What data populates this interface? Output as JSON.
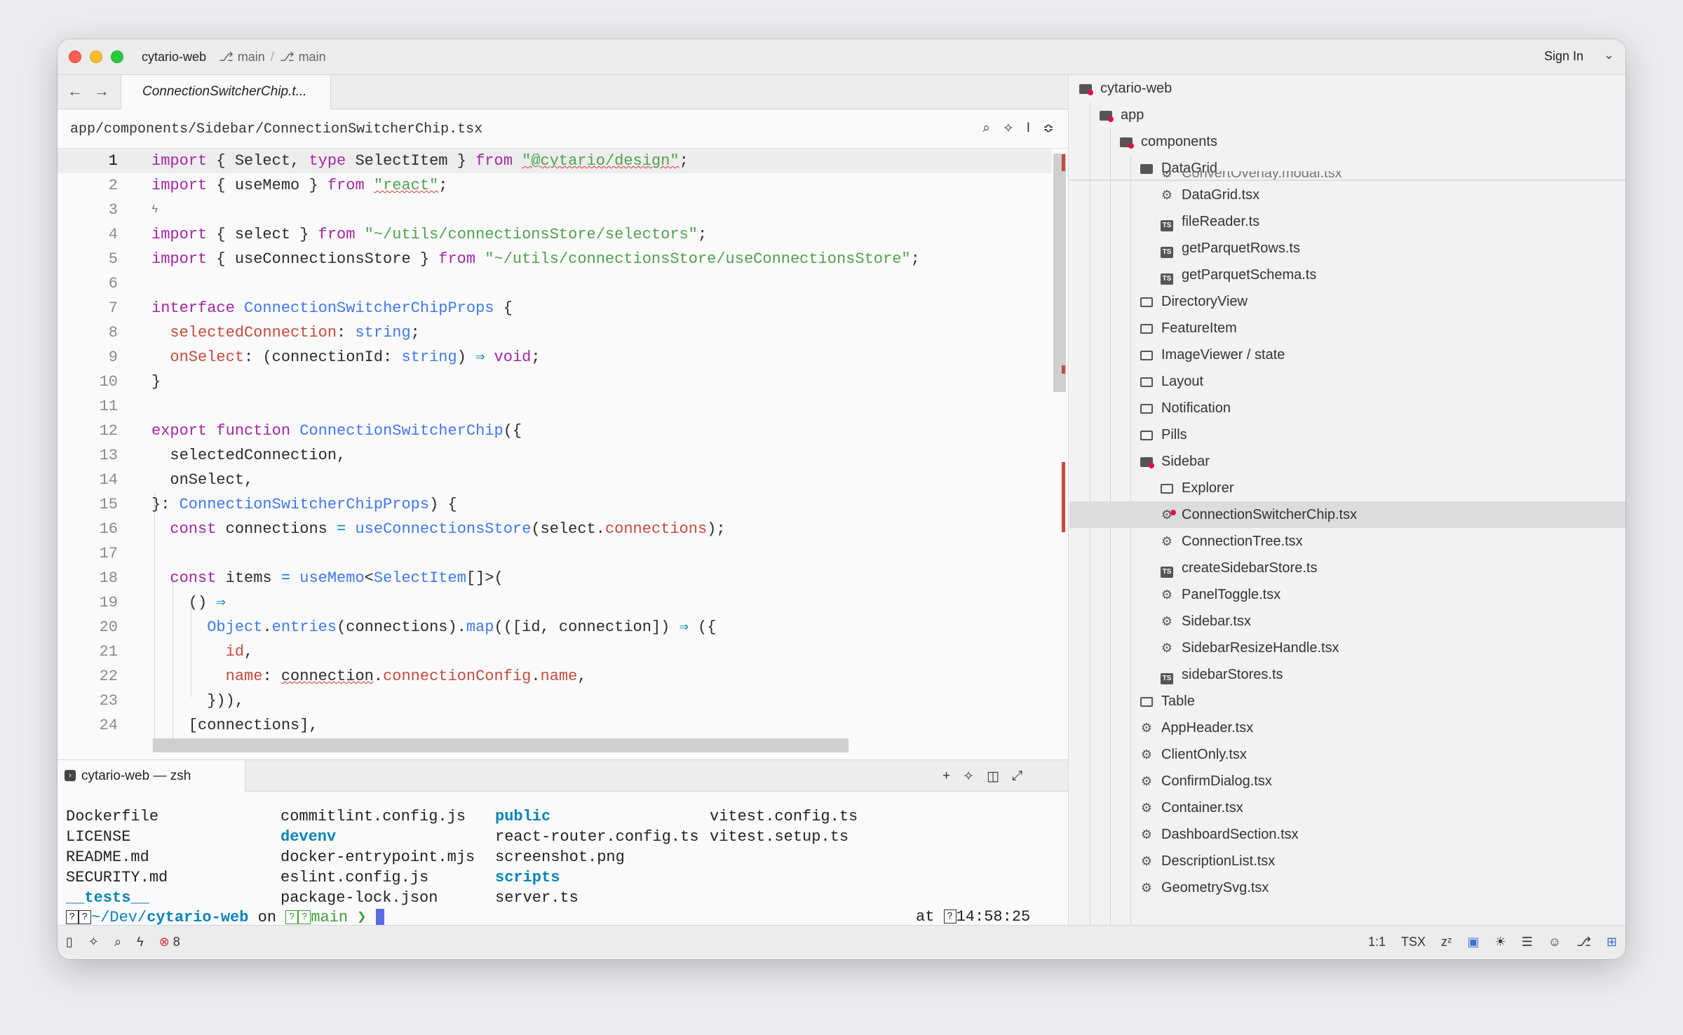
{
  "titlebar": {
    "project": "cytario-web",
    "branch1": "main",
    "branch2": "main",
    "sign_in": "Sign In"
  },
  "editor": {
    "tab_title": "ConnectionSwitcherChip.t...",
    "breadcrumb": "app/components/Sidebar/ConnectionSwitcherChip.tsx",
    "lines": [
      "1",
      "2",
      "3",
      "4",
      "5",
      "6",
      "7",
      "8",
      "9",
      "10",
      "11",
      "12",
      "13",
      "14",
      "15",
      "16",
      "17",
      "18",
      "19",
      "20",
      "21",
      "22",
      "23",
      "24"
    ]
  },
  "terminal": {
    "tab_title": "cytario-web — zsh",
    "col1": [
      "Dockerfile",
      "LICENSE",
      "README.md",
      "SECURITY.md",
      "__tests__"
    ],
    "col2": [
      "commitlint.config.js",
      "devenv",
      "docker-entrypoint.mjs",
      "eslint.config.js",
      "package-lock.json"
    ],
    "col3": [
      "public",
      "react-router.config.ts",
      "screenshot.png",
      "scripts",
      "server.ts"
    ],
    "col4": [
      "vitest.config.ts",
      "vitest.setup.ts"
    ],
    "prompt_path_prefix": "~/Dev/",
    "prompt_path_dir": "cytario-web",
    "prompt_on": "on",
    "prompt_branch": "main",
    "prompt_arrow": "❯",
    "prompt_at": "at",
    "prompt_time": "14:58:25"
  },
  "tree": {
    "root": "cytario-web",
    "app": "app",
    "components": "components",
    "datagrid": "DataGrid",
    "partial": "ConvertOverlay.modal.tsx",
    "items": [
      {
        "label": "DataGrid.tsx",
        "icon": "react-gear-icon"
      },
      {
        "label": "fileReader.ts",
        "icon": "typescript-icon"
      },
      {
        "label": "getParquetRows.ts",
        "icon": "typescript-icon"
      },
      {
        "label": "getParquetSchema.ts",
        "icon": "typescript-icon"
      }
    ],
    "folders": [
      "DirectoryView",
      "FeatureItem",
      "ImageViewer / state",
      "Layout",
      "Notification",
      "Pills"
    ],
    "sidebar": "Sidebar",
    "explorer": "Explorer",
    "sidebar_items": [
      {
        "label": "ConnectionSwitcherChip.tsx",
        "icon": "react-gear-icon",
        "selected": true
      },
      {
        "label": "ConnectionTree.tsx",
        "icon": "react-gear-icon"
      },
      {
        "label": "createSidebarStore.ts",
        "icon": "typescript-icon"
      },
      {
        "label": "PanelToggle.tsx",
        "icon": "react-gear-icon"
      },
      {
        "label": "Sidebar.tsx",
        "icon": "react-gear-icon"
      },
      {
        "label": "SidebarResizeHandle.tsx",
        "icon": "react-gear-icon"
      },
      {
        "label": "sidebarStores.ts",
        "icon": "typescript-icon"
      }
    ],
    "table": "Table",
    "component_files": [
      "AppHeader.tsx",
      "ClientOnly.tsx",
      "ConfirmDialog.tsx",
      "Container.tsx",
      "DashboardSection.tsx",
      "DescriptionList.tsx",
      "GeometrySvg.tsx"
    ]
  },
  "status": {
    "errors": "8",
    "position": "1:1",
    "language": "TSX"
  },
  "colors": {
    "keyword": "#a626a4",
    "function": "#4078f2",
    "string": "#50a14f",
    "property": "#c64b3f",
    "error": "#dd3333"
  }
}
